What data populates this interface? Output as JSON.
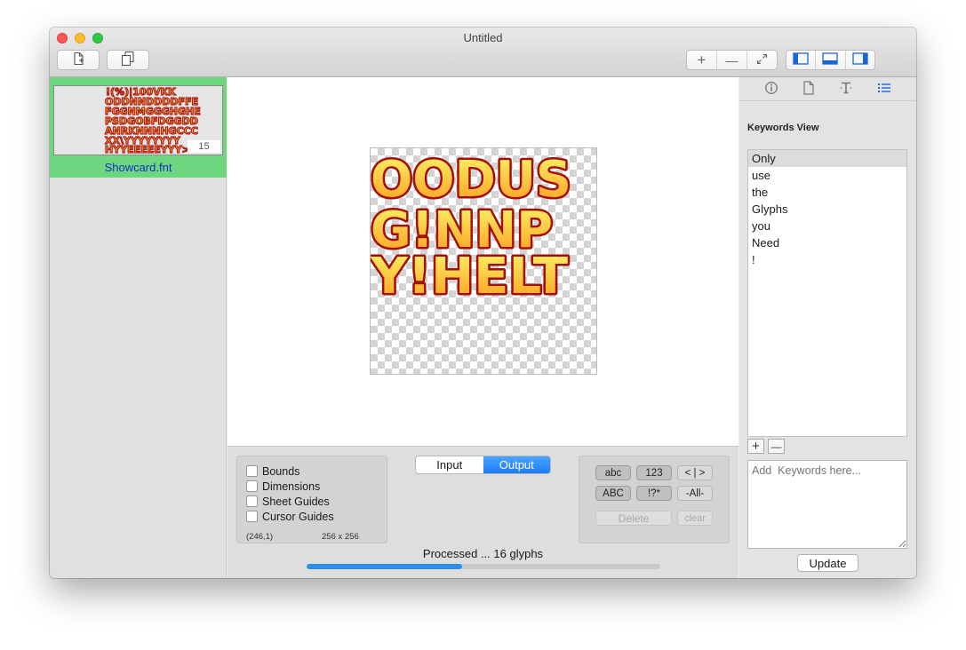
{
  "window": {
    "title": "Untitled"
  },
  "toolbar": {
    "new_doc_icon": "new-document-icon",
    "copy_icon": "copy-icon",
    "zoom_in": "+",
    "zoom_out": "—",
    "fit_icon": "expand-icon",
    "view_icons": [
      "left-panel-icon",
      "bottom-panel-icon",
      "right-panel-icon"
    ]
  },
  "sidebar": {
    "items": [
      {
        "label": "Showcard.fnt",
        "count": "15"
      }
    ]
  },
  "preview": {
    "rows": [
      "OODUS",
      "G!NNP",
      "Y!HELT"
    ],
    "fill_top": "#f9f66a",
    "fill_bottom": "#ff9a1c",
    "stroke": "#a3100c"
  },
  "options": {
    "checkboxes": [
      "Bounds",
      "Dimensions",
      "Sheet Guides",
      "Cursor Guides"
    ],
    "cursor": "(246,1)",
    "size": "256 x 256"
  },
  "mode": {
    "tabs": [
      "Input",
      "Output"
    ],
    "selected": "Output"
  },
  "charset": {
    "buttons": [
      "abc",
      "123",
      "< | >",
      "ABC",
      "!?*",
      "-All-"
    ],
    "delete": "Delete",
    "clear": "clear"
  },
  "status": {
    "text": "Processed ... 16 glyphs",
    "progress": 0.44
  },
  "inspector": {
    "tabs": [
      "info-icon",
      "document-icon",
      "text-icon",
      "list-icon"
    ],
    "title": "Keywords View",
    "keywords": [
      "Only",
      "use",
      "the",
      "Glyphs",
      "you",
      "Need",
      "!"
    ],
    "add": "+",
    "remove": "—",
    "placeholder": "Add  Keywords here...",
    "update": "Update"
  },
  "colors": {
    "accent": "#1a7cf5",
    "selection": "#6ed67e",
    "link": "#1530c8"
  }
}
